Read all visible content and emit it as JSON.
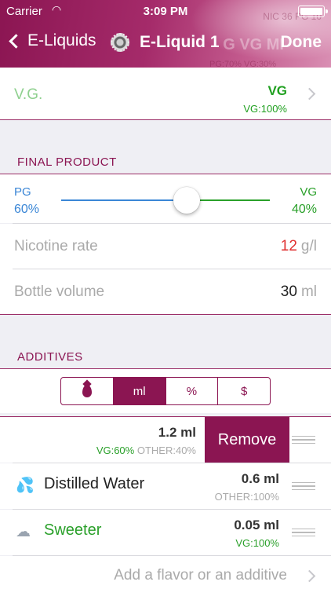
{
  "status": {
    "carrier": "Carrier",
    "time": "3:09 PM"
  },
  "nav": {
    "back_label": "E-Liquids",
    "title": "E-Liquid 1",
    "done_label": "Done"
  },
  "header_ghost": {
    "line1": "NIC 36 PG 10",
    "line2": "G VG MI",
    "line3": "PG:70% VG:30%"
  },
  "vg_row": {
    "label": "V.G.",
    "value": "VG",
    "sub": "VG:100%"
  },
  "final_product": {
    "section_title": "FINAL PRODUCT",
    "pg_label": "PG",
    "pg_value": "60%",
    "vg_label": "VG",
    "vg_value": "40%",
    "pg_fraction": 0.6,
    "nicotine": {
      "label": "Nicotine rate",
      "value": "12",
      "unit": "g/l"
    },
    "bottle": {
      "label": "Bottle volume",
      "value": "30",
      "unit": "ml"
    }
  },
  "additives": {
    "section_title": "ADDITIVES",
    "segments": [
      "",
      "ml",
      "%",
      "$"
    ],
    "active_segment": 1,
    "items": [
      {
        "name": "",
        "amount": "1.2 ml",
        "comp_vg": "VG:60%",
        "comp_other": "OTHER:40%",
        "remove_label": "Remove"
      },
      {
        "name": "Distilled Water",
        "amount": "0.6 ml",
        "comp_vg": "",
        "comp_other": "OTHER:100%"
      },
      {
        "name": "Sweeter",
        "amount": "0.05 ml",
        "comp_vg": "VG:100%",
        "comp_other": ""
      }
    ],
    "add_label": "Add a flavor or an additive"
  },
  "colors": {
    "accent": "#8b1552",
    "pg": "#3a86d6",
    "vg": "#2aa02a",
    "red": "#e03030"
  }
}
